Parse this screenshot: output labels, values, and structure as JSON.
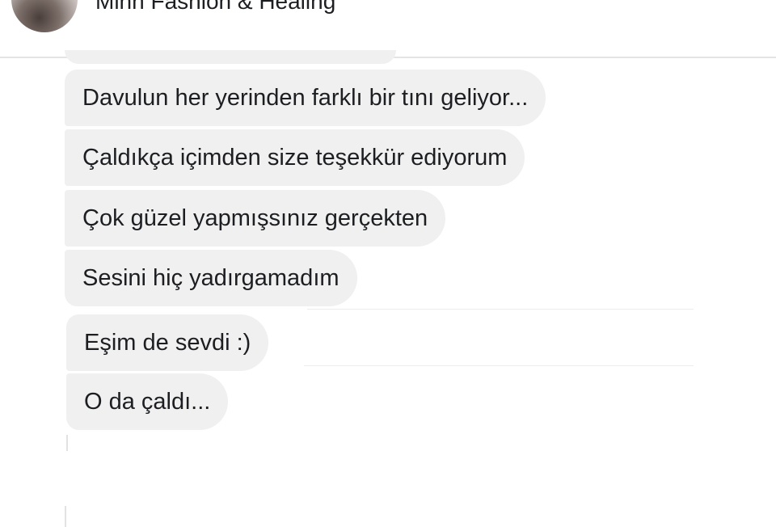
{
  "header": {
    "contact_name": "Minh Fashion & Healing"
  },
  "messages": [
    {
      "text": "Davulun her yerinden farklı bir tını geliyor..."
    },
    {
      "text": "Çaldıkça içimden size teşekkür ediyorum"
    },
    {
      "text": "Çok güzel yapmışsınız gerçekten"
    },
    {
      "text": "Sesini hiç yadırgamadım"
    },
    {
      "text": "Eşim de sevdi :)"
    },
    {
      "text": "O da çaldı..."
    }
  ],
  "colors": {
    "bubble_background": "#f0f0f0",
    "text": "#1c1e21",
    "header_divider": "#e4e4e4"
  }
}
